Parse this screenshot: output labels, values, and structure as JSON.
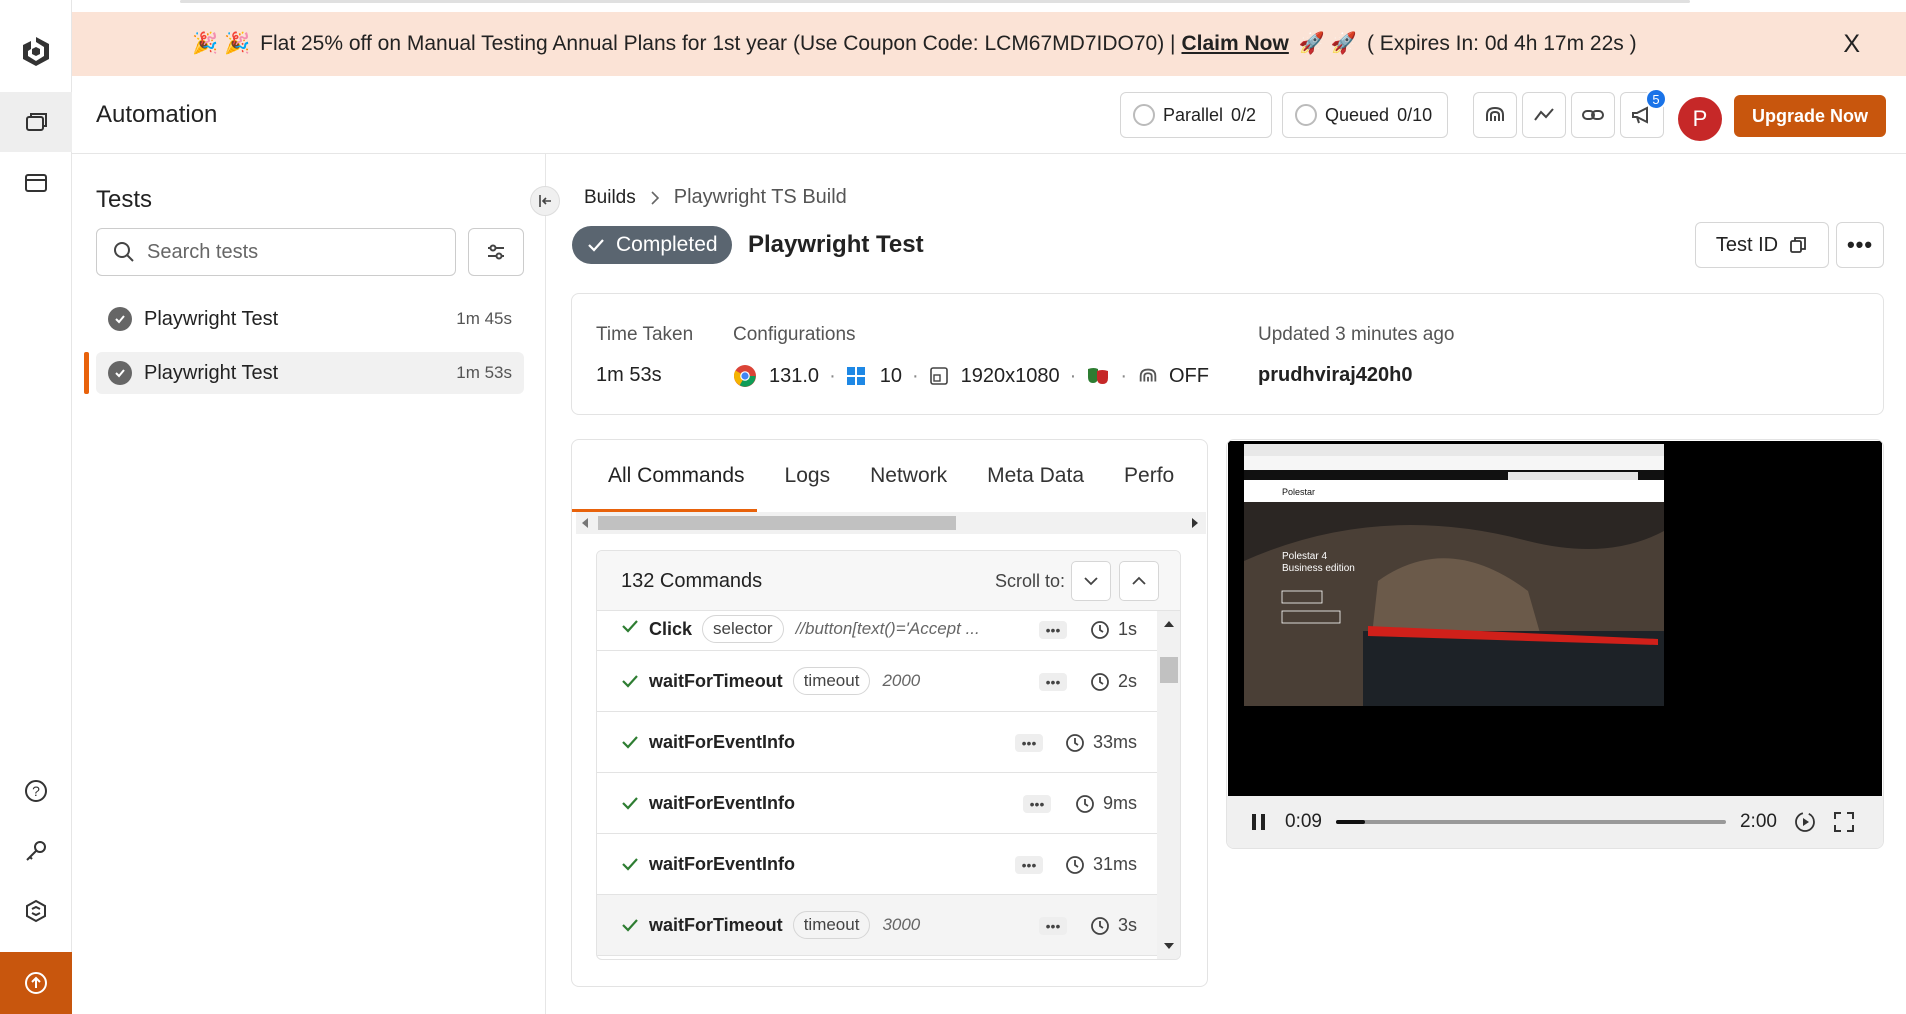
{
  "banner": {
    "emoji_left": "🎉 🎉",
    "text": "Flat 25% off on Manual Testing Annual Plans for 1st year",
    "coupon": "(Use Coupon Code: LCM67MD7IDO70) |",
    "claim": "Claim Now",
    "emoji_right": "🚀 🚀",
    "expires": "( Expires In: 0d 4h 17m 22s )",
    "close": "X"
  },
  "header": {
    "title": "Automation",
    "parallel_label": "Parallel",
    "parallel_value": "0/2",
    "queued_label": "Queued",
    "queued_value": "0/10",
    "notification_count": "5",
    "avatar_initial": "P",
    "upgrade_label": "Upgrade Now"
  },
  "sidebar": {
    "heading": "Tests",
    "search_placeholder": "Search tests",
    "tests": [
      {
        "name": "Playwright Test",
        "duration": "1m 45s"
      },
      {
        "name": "Playwright Test",
        "duration": "1m 53s"
      }
    ]
  },
  "breadcrumb": {
    "root": "Builds",
    "current": "Playwright TS Build"
  },
  "test": {
    "status": "Completed",
    "name": "Playwright Test",
    "test_id_label": "Test ID",
    "more_label": "•••"
  },
  "info": {
    "time_taken_label": "Time Taken",
    "time_taken": "1m 53s",
    "config_label": "Configurations",
    "browser_version": "131.0",
    "os_version": "10",
    "resolution": "1920x1080",
    "tunnel": "OFF",
    "updated_label": "Updated 3 minutes ago",
    "user": "prudhviraj420h0"
  },
  "tabs": [
    "All Commands",
    "Logs",
    "Network",
    "Meta Data",
    "Perfo"
  ],
  "commands": {
    "count_label": "132 Commands",
    "scroll_to_label": "Scroll to:",
    "rows": [
      {
        "name": "Click",
        "tag": "selector",
        "arg": "//button[text()='Accept ...",
        "time": "1s"
      },
      {
        "name": "waitForTimeout",
        "tag": "timeout",
        "arg": "2000",
        "time": "2s"
      },
      {
        "name": "waitForEventInfo",
        "tag": "",
        "arg": "",
        "time": "33ms"
      },
      {
        "name": "waitForEventInfo",
        "tag": "",
        "arg": "",
        "time": "9ms"
      },
      {
        "name": "waitForEventInfo",
        "tag": "",
        "arg": "",
        "time": "31ms"
      },
      {
        "name": "waitForTimeout",
        "tag": "timeout",
        "arg": "3000",
        "time": "3s"
      }
    ]
  },
  "video": {
    "current_time": "0:09",
    "duration": "2:00",
    "progress": 0.075,
    "page_brand": "Polestar",
    "page_heading": "Polestar 4",
    "page_subheading": "Business edition"
  },
  "colors": {
    "accent": "#c8560d",
    "banner_bg": "#fbe3d6",
    "status_bg": "#5a6570",
    "success": "#2e7d32"
  }
}
